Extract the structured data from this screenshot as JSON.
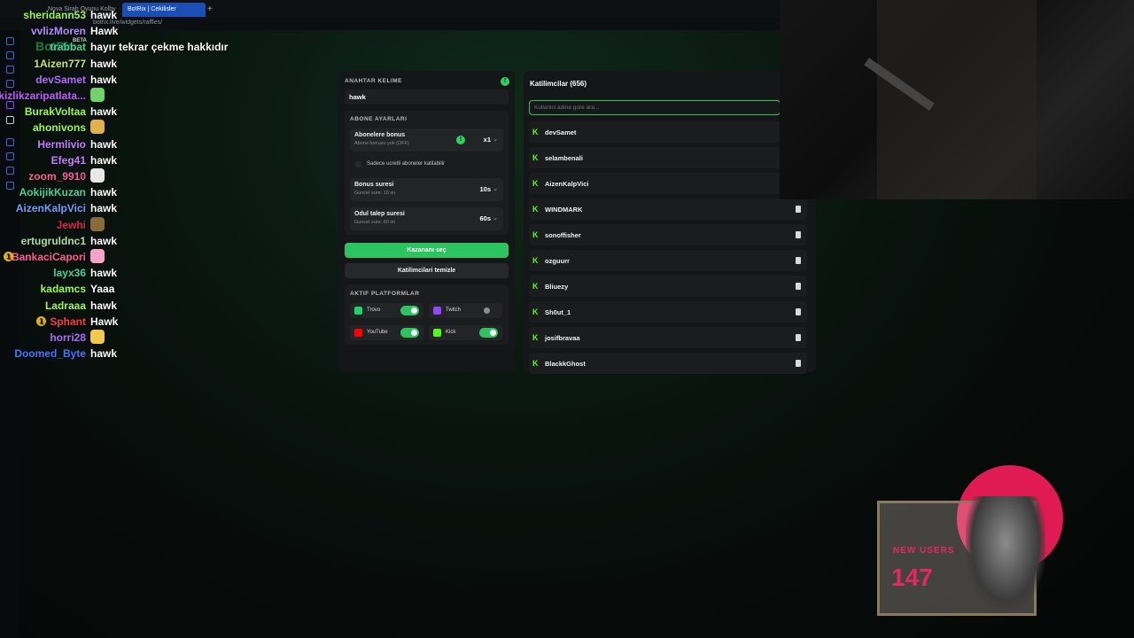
{
  "browser": {
    "tab_inactive": "Nova Sirah Oyunu Kolby",
    "tab_active": "BotRix | Cekilisler",
    "new_tab": "+",
    "url": "botrix.live/widgets/raffles/",
    "logo": "BotRix",
    "beta": "BETA"
  },
  "chat": {
    "messages": [
      {
        "user": "sheridann53",
        "msg": "hawk",
        "color": "#9bff3a"
      },
      {
        "user": "vvlizMoren",
        "msg": "Hawk",
        "color": "#b58cff"
      },
      {
        "user": "trabbat",
        "msg": "hayır tekrar çekme hakkıdır",
        "color": "#3cd6a0"
      },
      {
        "user": "1Aizen777",
        "msg": "hawk",
        "color": "#c7e86a"
      },
      {
        "user": "devSamet",
        "msg": "hawk",
        "color": "#b36bff"
      },
      {
        "user": "kizlikzaripatlata...",
        "msg": "",
        "emote": "frog-emote",
        "color": "#c05cff"
      },
      {
        "user": "BurakVoltaa",
        "msg": "hawk",
        "color": "#9bff3a"
      },
      {
        "user": "ahonivons",
        "msg": "",
        "emote": "cat-emote",
        "color": "#9bff3a"
      },
      {
        "user": "Hermlivio",
        "msg": "hawk",
        "color": "#c97bff"
      },
      {
        "user": "Efeg41",
        "msg": "hawk",
        "color": "#c97bff"
      },
      {
        "user": "zoom_9910",
        "msg": "",
        "emote": "soup-emote",
        "color": "#ff5c9a"
      },
      {
        "user": "AokijikKuzan",
        "msg": "hawk",
        "color": "#3cd6a0"
      },
      {
        "user": "AizenKalpVici",
        "msg": "hawk",
        "color": "#6fa0ff"
      },
      {
        "user": "Jewhi",
        "msg": "",
        "emote": "hat-emote",
        "color": "#d8284c"
      },
      {
        "user": "ertugruldnc1",
        "msg": "hawk",
        "color": "#a9e0a0"
      },
      {
        "user": "BankaciCapori",
        "msg": "",
        "emote": "pig-emote",
        "color": "#ff5c9a",
        "badge": true
      },
      {
        "user": "layx36",
        "msg": "hawk",
        "color": "#3cd6a0"
      },
      {
        "user": "kadamcs",
        "msg": "Yaaa",
        "color": "#9bff3a"
      },
      {
        "user": "Ladraaa",
        "msg": "hawk",
        "color": "#9bff3a"
      },
      {
        "user": "Sphant",
        "msg": "Hawk",
        "color": "#ff3b3b",
        "badge": true
      },
      {
        "user": "horri28",
        "msg": "",
        "emote": "dog-emote",
        "color": "#b36bff"
      },
      {
        "user": "Doomed_Byte",
        "msg": "hawk",
        "color": "#3a7bff"
      }
    ],
    "badge_symbol": "1"
  },
  "raffle": {
    "keyword_label": "ANAHTAR KELIME",
    "keyword_value": "hawk",
    "info_symbol": "!",
    "subscriber_section": "ABONE AYARLARI",
    "sub_bonus_title": "Abonelere bonus",
    "sub_bonus_sub": "Abone bonusu yok (OFF)",
    "sub_bonus_value": "x1",
    "only_paid_label": "Sadece ucretli aboneler katilabilir",
    "bonus_time_title": "Bonus suresi",
    "bonus_time_sub": "Guncel sure: 10 sn",
    "bonus_time_value": "10s",
    "claim_time_title": "Odul talep suresi",
    "claim_time_sub": "Guncel sure: 60 sn",
    "claim_time_value": "60s",
    "pick_winner": "Kazananı seç",
    "clear_participants": "Katilimcilari temizle",
    "platforms_label": "AKTIF PLATFORMLAR",
    "platforms": [
      {
        "name": "Trovo",
        "color": "#19d66b",
        "on": true
      },
      {
        "name": "Twitch",
        "color": "#9146ff",
        "on": false
      },
      {
        "name": "YouTube",
        "color": "#ff0000",
        "on": true
      },
      {
        "name": "Kick",
        "color": "#53fc18",
        "on": true
      }
    ],
    "chevron": "⌄"
  },
  "participants": {
    "title": "Katilimcilar (656)",
    "search_placeholder": "Kullanici adina gore ara...",
    "k_glyph": "K",
    "list": [
      "devSamet",
      "selambenali",
      "AizenKalpVici",
      "WINDMARK",
      "sonoffisher",
      "ozguurr",
      "Bliuezy",
      "Sh0ut_1",
      "josifbravaa",
      "BlackkGhost"
    ]
  },
  "overlay": {
    "new_users_label": "NEW USERS",
    "new_users_count": "147"
  }
}
